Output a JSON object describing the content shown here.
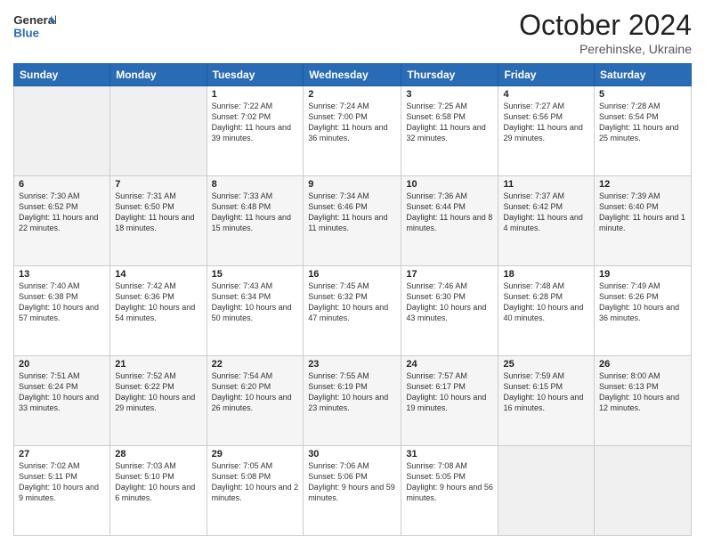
{
  "logo": {
    "general": "General",
    "blue": "Blue"
  },
  "header": {
    "month": "October 2024",
    "location": "Perehinske, Ukraine"
  },
  "days_of_week": [
    "Sunday",
    "Monday",
    "Tuesday",
    "Wednesday",
    "Thursday",
    "Friday",
    "Saturday"
  ],
  "weeks": [
    [
      {
        "day": "",
        "info": ""
      },
      {
        "day": "",
        "info": ""
      },
      {
        "day": "1",
        "info": "Sunrise: 7:22 AM\nSunset: 7:02 PM\nDaylight: 11 hours and 39 minutes."
      },
      {
        "day": "2",
        "info": "Sunrise: 7:24 AM\nSunset: 7:00 PM\nDaylight: 11 hours and 36 minutes."
      },
      {
        "day": "3",
        "info": "Sunrise: 7:25 AM\nSunset: 6:58 PM\nDaylight: 11 hours and 32 minutes."
      },
      {
        "day": "4",
        "info": "Sunrise: 7:27 AM\nSunset: 6:56 PM\nDaylight: 11 hours and 29 minutes."
      },
      {
        "day": "5",
        "info": "Sunrise: 7:28 AM\nSunset: 6:54 PM\nDaylight: 11 hours and 25 minutes."
      }
    ],
    [
      {
        "day": "6",
        "info": "Sunrise: 7:30 AM\nSunset: 6:52 PM\nDaylight: 11 hours and 22 minutes."
      },
      {
        "day": "7",
        "info": "Sunrise: 7:31 AM\nSunset: 6:50 PM\nDaylight: 11 hours and 18 minutes."
      },
      {
        "day": "8",
        "info": "Sunrise: 7:33 AM\nSunset: 6:48 PM\nDaylight: 11 hours and 15 minutes."
      },
      {
        "day": "9",
        "info": "Sunrise: 7:34 AM\nSunset: 6:46 PM\nDaylight: 11 hours and 11 minutes."
      },
      {
        "day": "10",
        "info": "Sunrise: 7:36 AM\nSunset: 6:44 PM\nDaylight: 11 hours and 8 minutes."
      },
      {
        "day": "11",
        "info": "Sunrise: 7:37 AM\nSunset: 6:42 PM\nDaylight: 11 hours and 4 minutes."
      },
      {
        "day": "12",
        "info": "Sunrise: 7:39 AM\nSunset: 6:40 PM\nDaylight: 11 hours and 1 minute."
      }
    ],
    [
      {
        "day": "13",
        "info": "Sunrise: 7:40 AM\nSunset: 6:38 PM\nDaylight: 10 hours and 57 minutes."
      },
      {
        "day": "14",
        "info": "Sunrise: 7:42 AM\nSunset: 6:36 PM\nDaylight: 10 hours and 54 minutes."
      },
      {
        "day": "15",
        "info": "Sunrise: 7:43 AM\nSunset: 6:34 PM\nDaylight: 10 hours and 50 minutes."
      },
      {
        "day": "16",
        "info": "Sunrise: 7:45 AM\nSunset: 6:32 PM\nDaylight: 10 hours and 47 minutes."
      },
      {
        "day": "17",
        "info": "Sunrise: 7:46 AM\nSunset: 6:30 PM\nDaylight: 10 hours and 43 minutes."
      },
      {
        "day": "18",
        "info": "Sunrise: 7:48 AM\nSunset: 6:28 PM\nDaylight: 10 hours and 40 minutes."
      },
      {
        "day": "19",
        "info": "Sunrise: 7:49 AM\nSunset: 6:26 PM\nDaylight: 10 hours and 36 minutes."
      }
    ],
    [
      {
        "day": "20",
        "info": "Sunrise: 7:51 AM\nSunset: 6:24 PM\nDaylight: 10 hours and 33 minutes."
      },
      {
        "day": "21",
        "info": "Sunrise: 7:52 AM\nSunset: 6:22 PM\nDaylight: 10 hours and 29 minutes."
      },
      {
        "day": "22",
        "info": "Sunrise: 7:54 AM\nSunset: 6:20 PM\nDaylight: 10 hours and 26 minutes."
      },
      {
        "day": "23",
        "info": "Sunrise: 7:55 AM\nSunset: 6:19 PM\nDaylight: 10 hours and 23 minutes."
      },
      {
        "day": "24",
        "info": "Sunrise: 7:57 AM\nSunset: 6:17 PM\nDaylight: 10 hours and 19 minutes."
      },
      {
        "day": "25",
        "info": "Sunrise: 7:59 AM\nSunset: 6:15 PM\nDaylight: 10 hours and 16 minutes."
      },
      {
        "day": "26",
        "info": "Sunrise: 8:00 AM\nSunset: 6:13 PM\nDaylight: 10 hours and 12 minutes."
      }
    ],
    [
      {
        "day": "27",
        "info": "Sunrise: 7:02 AM\nSunset: 5:11 PM\nDaylight: 10 hours and 9 minutes."
      },
      {
        "day": "28",
        "info": "Sunrise: 7:03 AM\nSunset: 5:10 PM\nDaylight: 10 hours and 6 minutes."
      },
      {
        "day": "29",
        "info": "Sunrise: 7:05 AM\nSunset: 5:08 PM\nDaylight: 10 hours and 2 minutes."
      },
      {
        "day": "30",
        "info": "Sunrise: 7:06 AM\nSunset: 5:06 PM\nDaylight: 9 hours and 59 minutes."
      },
      {
        "day": "31",
        "info": "Sunrise: 7:08 AM\nSunset: 5:05 PM\nDaylight: 9 hours and 56 minutes."
      },
      {
        "day": "",
        "info": ""
      },
      {
        "day": "",
        "info": ""
      }
    ]
  ]
}
